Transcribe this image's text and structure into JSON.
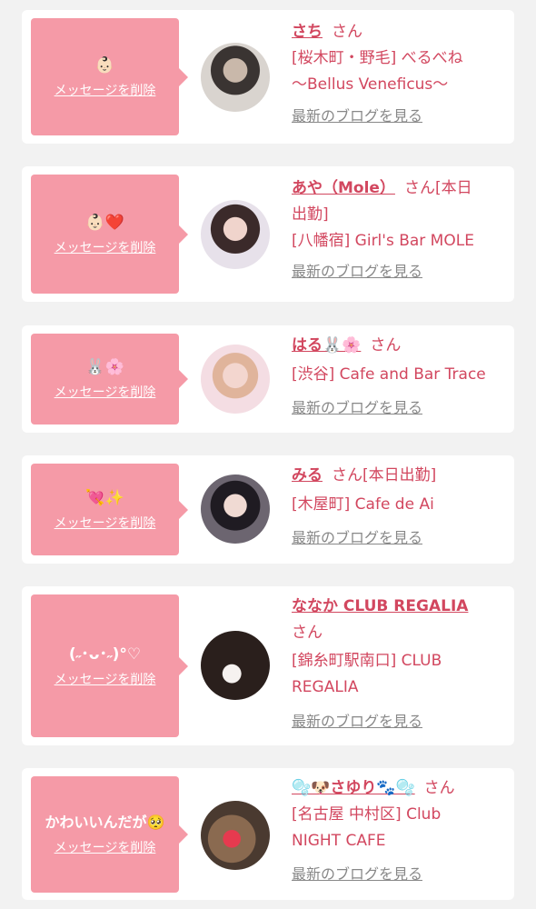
{
  "entries": [
    {
      "message": "👶🏻",
      "delete_label": "メッセージを削除",
      "name": "さち",
      "honorific": "さん",
      "location_lines": [
        "[桜木町・野毛] べるべね",
        "〜Bellus Veneficus〜"
      ],
      "blog_label": "最新のブログを見る"
    },
    {
      "message": "👶🏻❤️",
      "delete_label": "メッセージを削除",
      "name": "あや（Mole）",
      "honorific": "さん[本日",
      "extra_line": "出勤]",
      "location_lines": [
        "[八幡宿] Girl's Bar MOLE"
      ],
      "blog_label": "最新のブログを見る"
    },
    {
      "message": "🐰🌸",
      "delete_label": "メッセージを削除",
      "name": "はる🐰🌸",
      "honorific": "さん",
      "location_lines": [
        "[渋谷] Cafe and Bar Trace"
      ],
      "blog_label": "最新のブログを見る"
    },
    {
      "message": "💘✨",
      "delete_label": "メッセージを削除",
      "name": "みる",
      "honorific": "さん[本日出勤]",
      "location_lines": [
        "[木屋町] Cafe de Ai"
      ],
      "blog_label": "最新のブログを見る"
    },
    {
      "message": "(˶･ᴗ･˶)°♡",
      "delete_label": "メッセージを削除",
      "name": "ななか CLUB REGALIA",
      "honorific": "さん",
      "location_lines": [
        "[錦糸町駅南口] CLUB",
        "REGALIA"
      ],
      "blog_label": "最新のブログを見る"
    },
    {
      "message": "かわいいんだが🥺",
      "delete_label": "メッセージを削除",
      "name": "🫧🐶さゆり🐾🫧",
      "honorific": "さん",
      "location_lines": [
        "[名古屋 中村区] Club",
        "NIGHT CAFE"
      ],
      "blog_label": "最新のブログを見る"
    }
  ],
  "colors": {
    "accent": "#d2475f",
    "bubble": "#f59aa7",
    "background": "#f2f2f2",
    "link_gray": "#888888"
  }
}
